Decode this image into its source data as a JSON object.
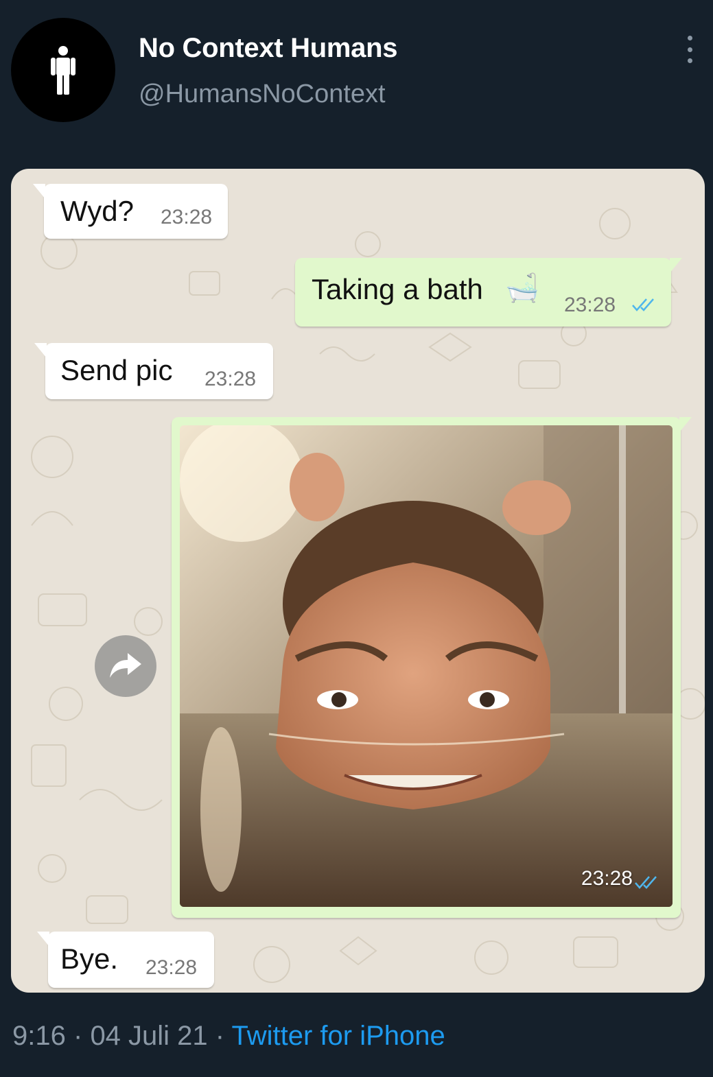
{
  "tweet": {
    "display_name": "No Context Humans",
    "handle": "@HumansNoContext",
    "avatar_icon": "person-icon",
    "more_icon": "more-vertical-icon",
    "time": "9:16",
    "date": "04 Juli 21",
    "separator": "·",
    "source": "Twitter for iPhone"
  },
  "chat": {
    "messages": [
      {
        "direction": "incoming",
        "text": "Wyd?",
        "time": "23:28"
      },
      {
        "direction": "outgoing",
        "text": "Taking a bath",
        "emoji": "🛁",
        "time": "23:28",
        "status": "read"
      },
      {
        "direction": "incoming",
        "text": "Send pic",
        "time": "23:28"
      },
      {
        "direction": "outgoing",
        "type": "photo",
        "time": "23:28",
        "status": "read"
      },
      {
        "direction": "incoming",
        "text": "Bye.",
        "time": "23:28"
      }
    ],
    "forward_icon": "forward-arrow-icon"
  },
  "colors": {
    "background": "#15202b",
    "link": "#1d9bf0",
    "outgoing_bubble": "#e1f8cc",
    "read_ticks": "#4fb6ec"
  }
}
